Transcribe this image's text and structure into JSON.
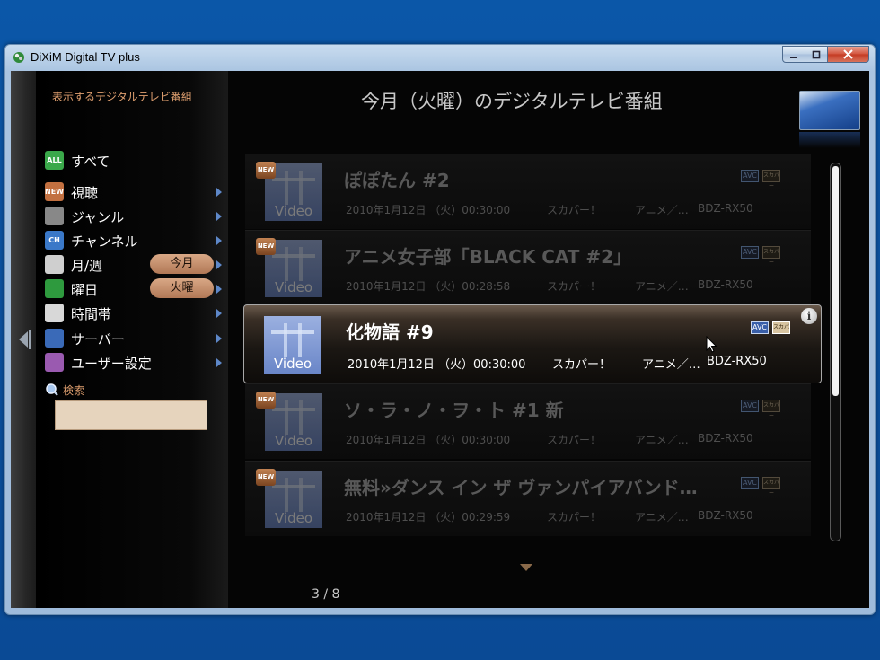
{
  "window": {
    "title": "DiXiM Digital TV plus"
  },
  "sidebar": {
    "heading": "表示するデジタルテレビ番組",
    "items": [
      {
        "label": "すべて",
        "icon": "all-icon",
        "icon_text": "ALL",
        "icon_color": "#3aa84a",
        "has_arrow": false,
        "badge": ""
      },
      {
        "label": "視聴",
        "icon": "new-icon",
        "icon_text": "NEW",
        "icon_color": "#c27040",
        "has_arrow": true,
        "badge": ""
      },
      {
        "label": "ジャンル",
        "icon": "genre-icon",
        "icon_text": "",
        "icon_color": "#888888",
        "has_arrow": true,
        "badge": ""
      },
      {
        "label": "チャンネル",
        "icon": "channel-icon",
        "icon_text": "CH",
        "icon_color": "#3a78c8",
        "has_arrow": true,
        "badge": ""
      },
      {
        "label": "月/週",
        "icon": "calendar-icon",
        "icon_text": "",
        "icon_color": "#cfcfcf",
        "has_arrow": true,
        "badge": "今月"
      },
      {
        "label": "曜日",
        "icon": "weekday-icon",
        "icon_text": "",
        "icon_color": "#2e9a3e",
        "has_arrow": true,
        "badge": "火曜"
      },
      {
        "label": "時間帯",
        "icon": "clock-icon",
        "icon_text": "",
        "icon_color": "#d8d8d8",
        "has_arrow": true,
        "badge": ""
      },
      {
        "label": "サーバー",
        "icon": "server-icon",
        "icon_text": "",
        "icon_color": "#3a6ab8",
        "has_arrow": true,
        "badge": ""
      },
      {
        "label": "ユーザー設定",
        "icon": "user-settings-icon",
        "icon_text": "",
        "icon_color": "#9a5ab0",
        "has_arrow": true,
        "badge": ""
      }
    ],
    "search": {
      "label": "検索",
      "value": "",
      "placeholder": ""
    }
  },
  "main": {
    "title": "今月（火曜）のデジタルテレビ番組",
    "thumb_label": "Video",
    "new_label": "NEW",
    "tags": {
      "avc": "AVC",
      "channel": "スカパー"
    },
    "programs": [
      {
        "title": "ぽぽたん #2",
        "date": "2010年1月12日 （火）00:30:00",
        "channel": "スカパー！",
        "genre": "アニメ／…",
        "server": "BDZ-RX50",
        "is_new": true,
        "selected": false
      },
      {
        "title": "アニメ女子部「BLACK CAT #2」",
        "date": "2010年1月12日 （火）00:28:58",
        "channel": "スカパー！",
        "genre": "アニメ／…",
        "server": "BDZ-RX50",
        "is_new": true,
        "selected": false
      },
      {
        "title": "化物語 #9",
        "date": "2010年1月12日 （火）00:30:00",
        "channel": "スカパー！",
        "genre": "アニメ／…",
        "server": "BDZ-RX50",
        "is_new": false,
        "selected": true
      },
      {
        "title": "ソ・ラ・ノ・ヲ・ト #1 新",
        "date": "2010年1月12日 （火）00:30:00",
        "channel": "スカパー！",
        "genre": "アニメ／…",
        "server": "BDZ-RX50",
        "is_new": true,
        "selected": false
      },
      {
        "title": "無料»ダンス イン ザ ヴァンパイアバンド…",
        "date": "2010年1月12日 （火）00:29:59",
        "channel": "スカパー！",
        "genre": "アニメ／…",
        "server": "BDZ-RX50",
        "is_new": true,
        "selected": false
      }
    ],
    "page_counter": "3 / 8",
    "scroll_fraction": 0.61
  }
}
